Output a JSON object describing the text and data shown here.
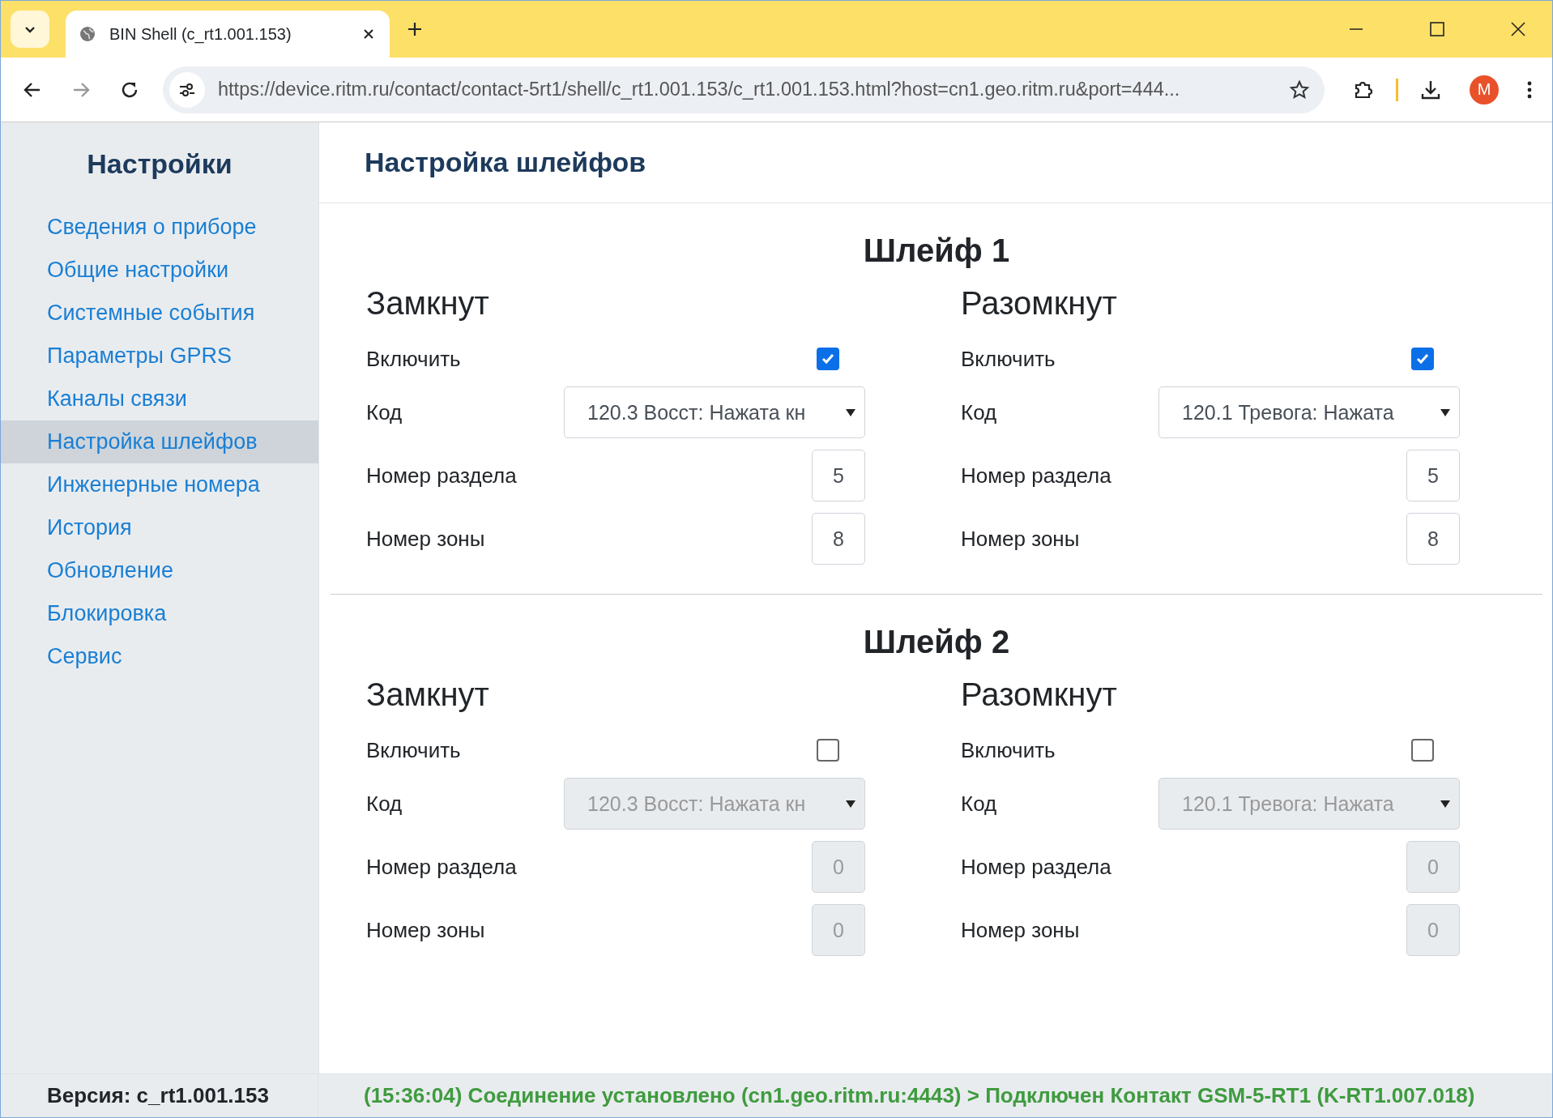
{
  "browser": {
    "tab_title": "BIN Shell (c_rt1.001.153)",
    "url": "https://device.ritm.ru/contact/contact-5rt1/shell/c_rt1.001.153/c_rt1.001.153.html?host=cn1.geo.ritm.ru&port=444...",
    "profile_initial": "M"
  },
  "sidebar": {
    "title": "Настройки",
    "items": [
      {
        "label": "Сведения о приборе",
        "selected": false
      },
      {
        "label": "Общие настройки",
        "selected": false
      },
      {
        "label": "Системные события",
        "selected": false
      },
      {
        "label": "Параметры GPRS",
        "selected": false
      },
      {
        "label": "Каналы связи",
        "selected": false
      },
      {
        "label": "Настройка шлейфов",
        "selected": true
      },
      {
        "label": "Инженерные номера",
        "selected": false
      },
      {
        "label": "История",
        "selected": false
      },
      {
        "label": "Обновление",
        "selected": false
      },
      {
        "label": "Блокировка",
        "selected": false
      },
      {
        "label": "Сервис",
        "selected": false
      }
    ],
    "version": "Версия: c_rt1.001.153"
  },
  "page_title": "Настройка шлейфов",
  "loops": [
    {
      "title": "Шлейф 1",
      "states": [
        {
          "title": "Замкнут",
          "enable_label": "Включить",
          "enabled": true,
          "code_label": "Код",
          "code": "120.3 Восст: Нажата кн",
          "partition_label": "Номер раздела",
          "partition": "5",
          "zone_label": "Номер зоны",
          "zone": "8"
        },
        {
          "title": "Разомкнут",
          "enable_label": "Включить",
          "enabled": true,
          "code_label": "Код",
          "code": "120.1 Тревога: Нажата",
          "partition_label": "Номер раздела",
          "partition": "5",
          "zone_label": "Номер зоны",
          "zone": "8"
        }
      ]
    },
    {
      "title": "Шлейф 2",
      "states": [
        {
          "title": "Замкнут",
          "enable_label": "Включить",
          "enabled": false,
          "code_label": "Код",
          "code": "120.3 Восст: Нажата кн",
          "partition_label": "Номер раздела",
          "partition": "0",
          "zone_label": "Номер зоны",
          "zone": "0"
        },
        {
          "title": "Разомкнут",
          "enable_label": "Включить",
          "enabled": false,
          "code_label": "Код",
          "code": "120.1 Тревога: Нажата",
          "partition_label": "Номер раздела",
          "partition": "0",
          "zone_label": "Номер зоны",
          "zone": "0"
        }
      ]
    }
  ],
  "status": "(15:36:04) Соединение установлено (cn1.geo.ritm.ru:4443) > Подключен Контакт GSM-5-RT1 (K-RT1.007.018)"
}
